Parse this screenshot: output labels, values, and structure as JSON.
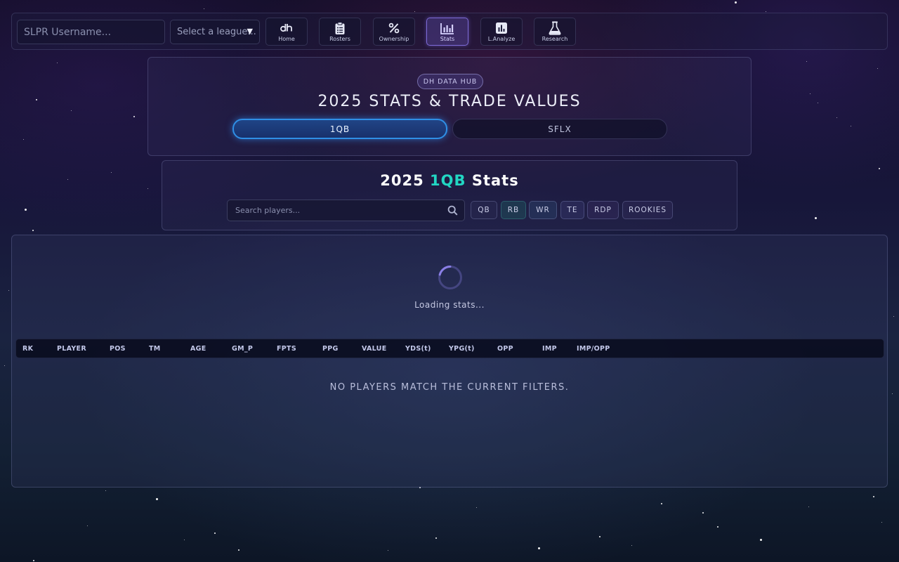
{
  "topbar": {
    "username_placeholder": "SLPR Username...",
    "league_placeholder": "Select a league...",
    "league_caret": "▼",
    "nav": [
      {
        "label": "Home",
        "icon": "dh-logo-icon"
      },
      {
        "label": "Rosters",
        "icon": "clipboard-icon"
      },
      {
        "label": "Ownership",
        "icon": "percent-icon"
      },
      {
        "label": "Stats",
        "icon": "bar-chart-icon",
        "active": true
      },
      {
        "label": "L.Analyze",
        "icon": "analyze-chart-icon"
      },
      {
        "label": "Research",
        "icon": "flask-icon"
      }
    ]
  },
  "hero": {
    "badge": "DH DATA HUB",
    "title": "2025 STATS & TRADE VALUES",
    "modes": [
      "1QB",
      "SFLX"
    ],
    "active_mode": "1QB"
  },
  "filters": {
    "title_year": "2025",
    "title_mode": "1QB",
    "title_suffix": "Stats",
    "search_placeholder": "Search players...",
    "positions": [
      "QB",
      "RB",
      "WR",
      "TE",
      "RDP",
      "ROOKIES"
    ]
  },
  "table": {
    "loading_text": "Loading stats...",
    "columns": [
      "RK",
      "PLAYER",
      "POS",
      "TM",
      "AGE",
      "GM_P",
      "FPTS",
      "PPG",
      "VALUE",
      "YDS(t)",
      "YPG(t)",
      "OPP",
      "IMP",
      "IMP/OPP"
    ],
    "empty_message": "NO PLAYERS MATCH THE CURRENT FILTERS."
  },
  "colors": {
    "accent_teal": "#22d6c3",
    "active_blue": "#2f8fe6",
    "active_nav_purple": "#9682ff"
  }
}
